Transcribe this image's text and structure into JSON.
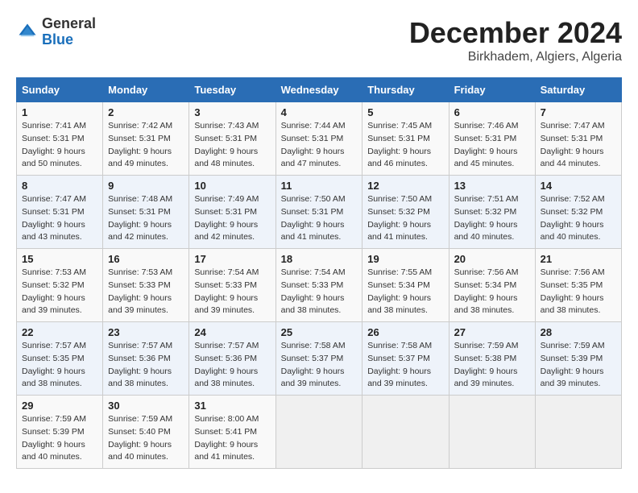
{
  "header": {
    "logo_general": "General",
    "logo_blue": "Blue",
    "month_title": "December 2024",
    "location": "Birkhadem, Algiers, Algeria"
  },
  "weekdays": [
    "Sunday",
    "Monday",
    "Tuesday",
    "Wednesday",
    "Thursday",
    "Friday",
    "Saturday"
  ],
  "weeks": [
    [
      {
        "day": "1",
        "sunrise": "Sunrise: 7:41 AM",
        "sunset": "Sunset: 5:31 PM",
        "daylight": "Daylight: 9 hours and 50 minutes."
      },
      {
        "day": "2",
        "sunrise": "Sunrise: 7:42 AM",
        "sunset": "Sunset: 5:31 PM",
        "daylight": "Daylight: 9 hours and 49 minutes."
      },
      {
        "day": "3",
        "sunrise": "Sunrise: 7:43 AM",
        "sunset": "Sunset: 5:31 PM",
        "daylight": "Daylight: 9 hours and 48 minutes."
      },
      {
        "day": "4",
        "sunrise": "Sunrise: 7:44 AM",
        "sunset": "Sunset: 5:31 PM",
        "daylight": "Daylight: 9 hours and 47 minutes."
      },
      {
        "day": "5",
        "sunrise": "Sunrise: 7:45 AM",
        "sunset": "Sunset: 5:31 PM",
        "daylight": "Daylight: 9 hours and 46 minutes."
      },
      {
        "day": "6",
        "sunrise": "Sunrise: 7:46 AM",
        "sunset": "Sunset: 5:31 PM",
        "daylight": "Daylight: 9 hours and 45 minutes."
      },
      {
        "day": "7",
        "sunrise": "Sunrise: 7:47 AM",
        "sunset": "Sunset: 5:31 PM",
        "daylight": "Daylight: 9 hours and 44 minutes."
      }
    ],
    [
      {
        "day": "8",
        "sunrise": "Sunrise: 7:47 AM",
        "sunset": "Sunset: 5:31 PM",
        "daylight": "Daylight: 9 hours and 43 minutes."
      },
      {
        "day": "9",
        "sunrise": "Sunrise: 7:48 AM",
        "sunset": "Sunset: 5:31 PM",
        "daylight": "Daylight: 9 hours and 42 minutes."
      },
      {
        "day": "10",
        "sunrise": "Sunrise: 7:49 AM",
        "sunset": "Sunset: 5:31 PM",
        "daylight": "Daylight: 9 hours and 42 minutes."
      },
      {
        "day": "11",
        "sunrise": "Sunrise: 7:50 AM",
        "sunset": "Sunset: 5:31 PM",
        "daylight": "Daylight: 9 hours and 41 minutes."
      },
      {
        "day": "12",
        "sunrise": "Sunrise: 7:50 AM",
        "sunset": "Sunset: 5:32 PM",
        "daylight": "Daylight: 9 hours and 41 minutes."
      },
      {
        "day": "13",
        "sunrise": "Sunrise: 7:51 AM",
        "sunset": "Sunset: 5:32 PM",
        "daylight": "Daylight: 9 hours and 40 minutes."
      },
      {
        "day": "14",
        "sunrise": "Sunrise: 7:52 AM",
        "sunset": "Sunset: 5:32 PM",
        "daylight": "Daylight: 9 hours and 40 minutes."
      }
    ],
    [
      {
        "day": "15",
        "sunrise": "Sunrise: 7:53 AM",
        "sunset": "Sunset: 5:32 PM",
        "daylight": "Daylight: 9 hours and 39 minutes."
      },
      {
        "day": "16",
        "sunrise": "Sunrise: 7:53 AM",
        "sunset": "Sunset: 5:33 PM",
        "daylight": "Daylight: 9 hours and 39 minutes."
      },
      {
        "day": "17",
        "sunrise": "Sunrise: 7:54 AM",
        "sunset": "Sunset: 5:33 PM",
        "daylight": "Daylight: 9 hours and 39 minutes."
      },
      {
        "day": "18",
        "sunrise": "Sunrise: 7:54 AM",
        "sunset": "Sunset: 5:33 PM",
        "daylight": "Daylight: 9 hours and 38 minutes."
      },
      {
        "day": "19",
        "sunrise": "Sunrise: 7:55 AM",
        "sunset": "Sunset: 5:34 PM",
        "daylight": "Daylight: 9 hours and 38 minutes."
      },
      {
        "day": "20",
        "sunrise": "Sunrise: 7:56 AM",
        "sunset": "Sunset: 5:34 PM",
        "daylight": "Daylight: 9 hours and 38 minutes."
      },
      {
        "day": "21",
        "sunrise": "Sunrise: 7:56 AM",
        "sunset": "Sunset: 5:35 PM",
        "daylight": "Daylight: 9 hours and 38 minutes."
      }
    ],
    [
      {
        "day": "22",
        "sunrise": "Sunrise: 7:57 AM",
        "sunset": "Sunset: 5:35 PM",
        "daylight": "Daylight: 9 hours and 38 minutes."
      },
      {
        "day": "23",
        "sunrise": "Sunrise: 7:57 AM",
        "sunset": "Sunset: 5:36 PM",
        "daylight": "Daylight: 9 hours and 38 minutes."
      },
      {
        "day": "24",
        "sunrise": "Sunrise: 7:57 AM",
        "sunset": "Sunset: 5:36 PM",
        "daylight": "Daylight: 9 hours and 38 minutes."
      },
      {
        "day": "25",
        "sunrise": "Sunrise: 7:58 AM",
        "sunset": "Sunset: 5:37 PM",
        "daylight": "Daylight: 9 hours and 39 minutes."
      },
      {
        "day": "26",
        "sunrise": "Sunrise: 7:58 AM",
        "sunset": "Sunset: 5:37 PM",
        "daylight": "Daylight: 9 hours and 39 minutes."
      },
      {
        "day": "27",
        "sunrise": "Sunrise: 7:59 AM",
        "sunset": "Sunset: 5:38 PM",
        "daylight": "Daylight: 9 hours and 39 minutes."
      },
      {
        "day": "28",
        "sunrise": "Sunrise: 7:59 AM",
        "sunset": "Sunset: 5:39 PM",
        "daylight": "Daylight: 9 hours and 39 minutes."
      }
    ],
    [
      {
        "day": "29",
        "sunrise": "Sunrise: 7:59 AM",
        "sunset": "Sunset: 5:39 PM",
        "daylight": "Daylight: 9 hours and 40 minutes."
      },
      {
        "day": "30",
        "sunrise": "Sunrise: 7:59 AM",
        "sunset": "Sunset: 5:40 PM",
        "daylight": "Daylight: 9 hours and 40 minutes."
      },
      {
        "day": "31",
        "sunrise": "Sunrise: 8:00 AM",
        "sunset": "Sunset: 5:41 PM",
        "daylight": "Daylight: 9 hours and 41 minutes."
      },
      null,
      null,
      null,
      null
    ]
  ]
}
